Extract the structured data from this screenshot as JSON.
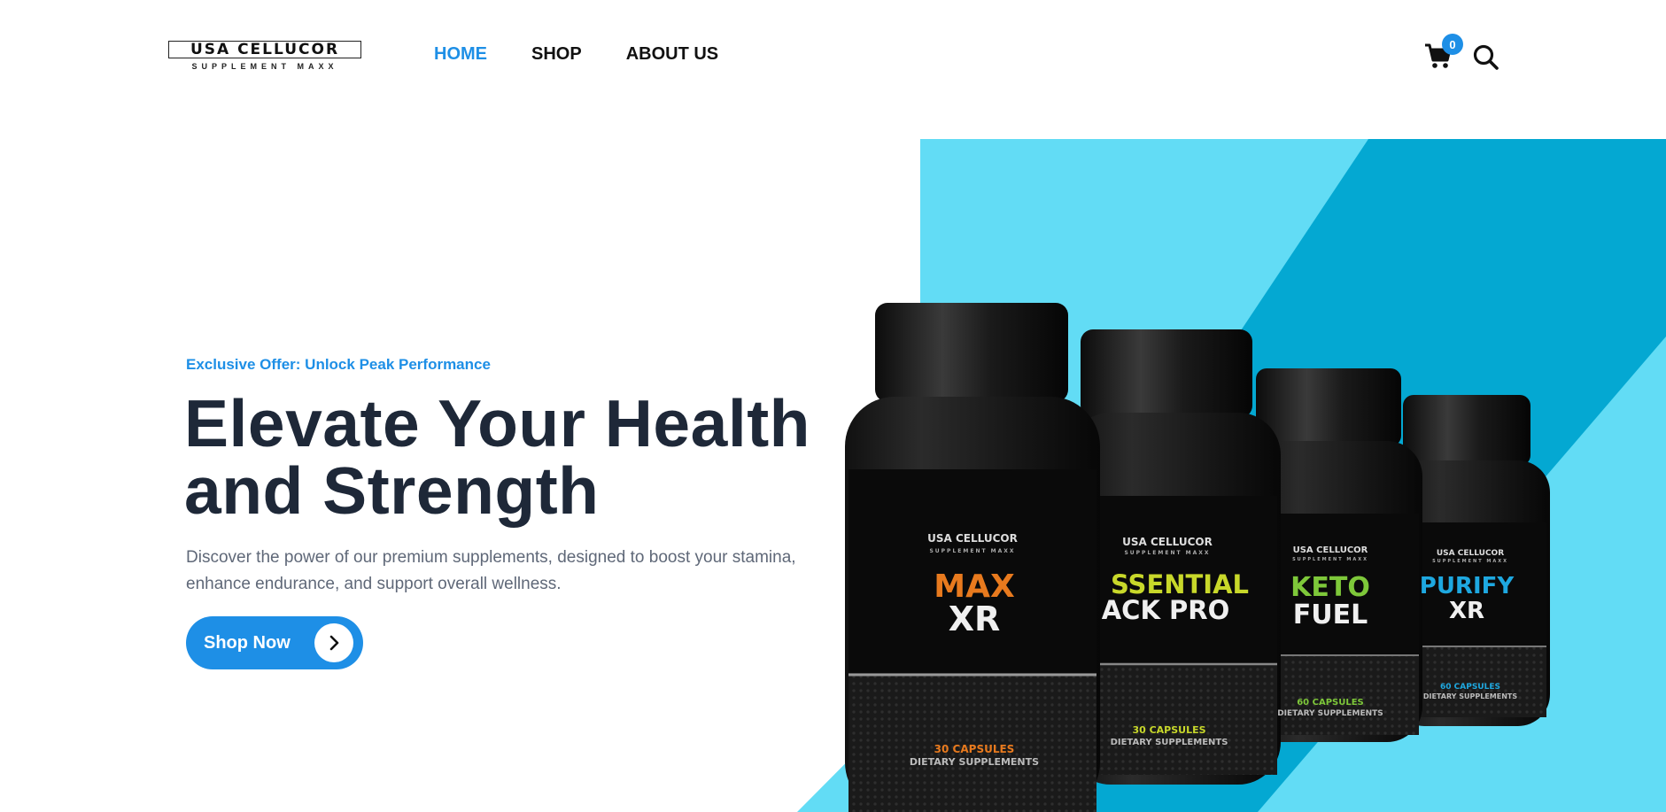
{
  "header": {
    "logo": {
      "main": "USA CELLUCOR",
      "sub": "SUPPLEMENT MAXX"
    },
    "nav": [
      {
        "label": "HOME",
        "active": true
      },
      {
        "label": "SHOP",
        "active": false
      },
      {
        "label": "ABOUT US",
        "active": false
      }
    ],
    "cart_count": "0",
    "icons": {
      "cart": "cart-icon",
      "search": "search-icon"
    }
  },
  "hero": {
    "eyebrow": "Exclusive Offer: Unlock Peak Performance",
    "headline_line1": "Elevate Your Health",
    "headline_line2": "and Strength",
    "description_line1": "Discover the power of our premium supplements, designed to boost your stamina,",
    "description_line2": "enhance endurance, and support overall wellness.",
    "cta_label": "Shop Now",
    "cta_icon": "chevron-right-icon"
  },
  "products": [
    {
      "brand": "USA CELLUCOR",
      "brand_sub": "SUPPLEMENT MAXX",
      "name_line1": "MAX",
      "name_line2": "XR",
      "capsules": "30 CAPSULES",
      "type": "DIETARY SUPPLEMENTS",
      "accent": "#e87a1e"
    },
    {
      "brand": "USA CELLUCOR",
      "brand_sub": "SUPPLEMENT MAXX",
      "name_line1": "SSENTIAL",
      "name_line2": "ACK PRO",
      "capsules": "30 CAPSULES",
      "type": "DIETARY SUPPLEMENTS",
      "accent": "#c8d82a"
    },
    {
      "brand": "USA CELLUCOR",
      "brand_sub": "SUPPLEMENT MAXX",
      "name_line1": "KETO",
      "name_line2": "FUEL",
      "capsules": "60 CAPSULES",
      "type": "DIETARY SUPPLEMENTS",
      "accent": "#7ec83a"
    },
    {
      "brand": "USA CELLUCOR",
      "brand_sub": "SUPPLEMENT MAXX",
      "name_line1": "PURIFY",
      "name_line2": "XR",
      "capsules": "60 CAPSULES",
      "type": "DIETARY SUPPLEMENTS",
      "accent": "#1ea8e0"
    }
  ],
  "colors": {
    "accent": "#1e8fe6",
    "headline": "#1e2838",
    "hero_light_blue": "#62dcf5",
    "hero_dark_blue": "#04a8d2"
  }
}
